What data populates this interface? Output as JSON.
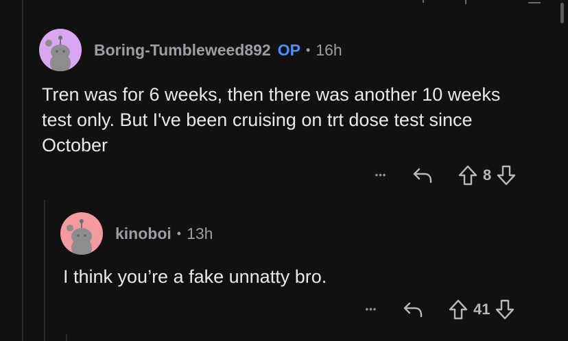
{
  "comments": [
    {
      "username": "Boring-Tumbleweed892",
      "op_badge": "OP",
      "separator": "•",
      "time": "16h",
      "body": "Tren was for 6 weeks, then there was another 10 weeks test only. But I've been cruising on trt dose test since October",
      "score": "8",
      "more_label": "•••",
      "avatar_color": "#d9a6f2"
    },
    {
      "username": "kinoboi",
      "separator": "•",
      "time": "13h",
      "body": "I think you’re a fake unnatty bro.",
      "score": "41",
      "more_label": "•••",
      "avatar_color": "#f29a9e"
    }
  ],
  "colors": {
    "background": "#111112",
    "op_badge": "#4f8ef7",
    "meta_text": "#9b9ea2"
  }
}
